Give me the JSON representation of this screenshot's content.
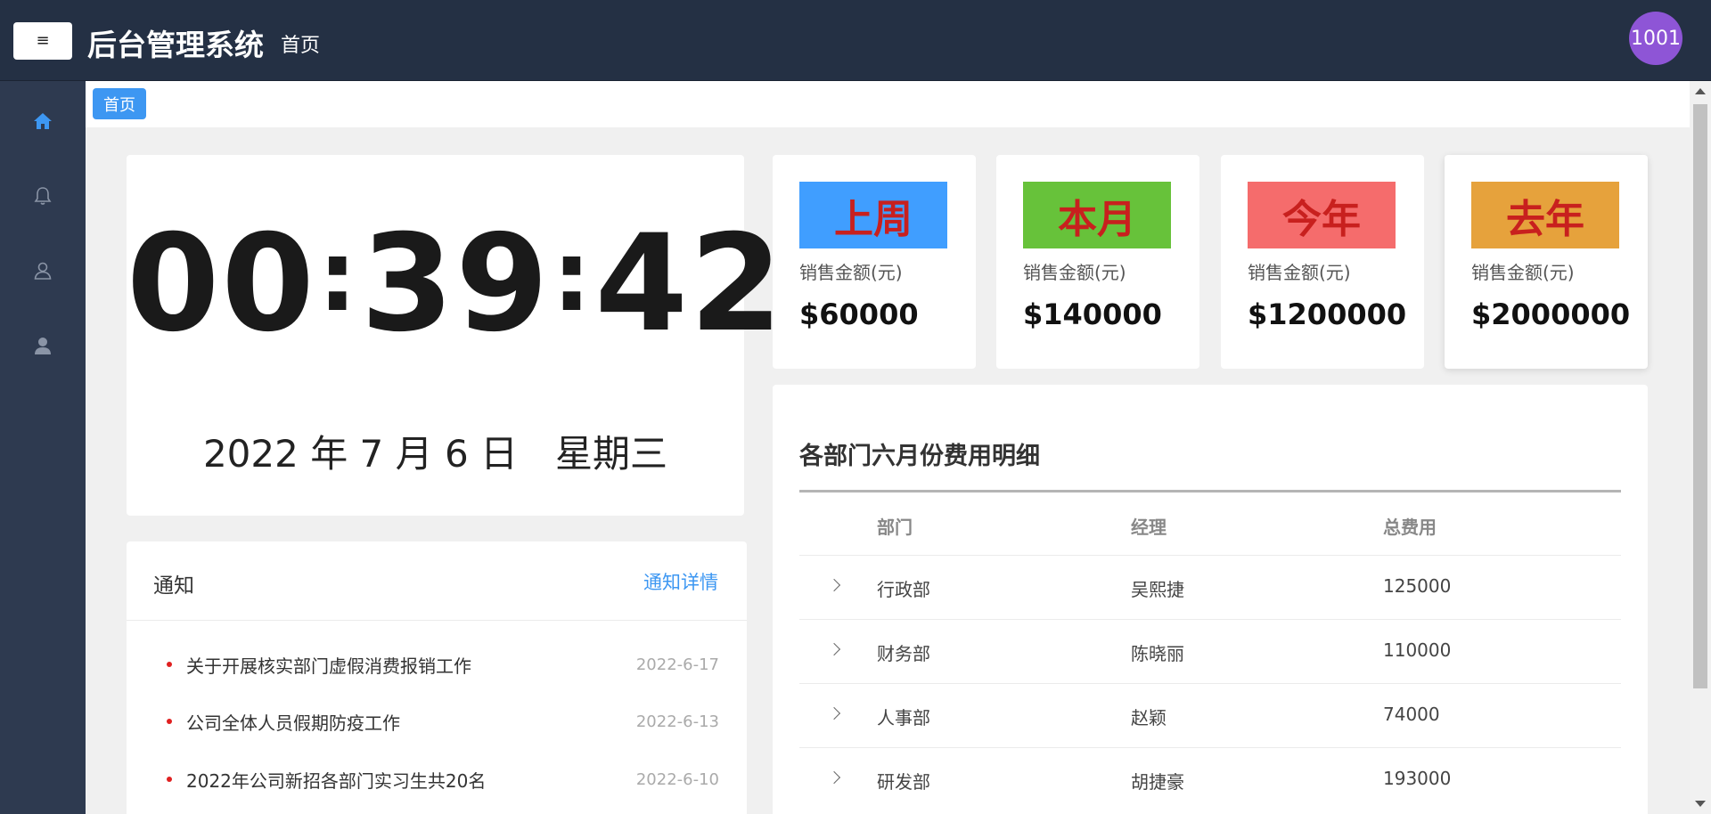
{
  "header": {
    "menu_icon": "≡",
    "app_title": "后台管理系统",
    "breadcrumb": "首页",
    "avatar_text": "1001"
  },
  "sidebar": {
    "items": [
      {
        "icon": "home-icon",
        "active": true
      },
      {
        "icon": "bell-icon",
        "active": false
      },
      {
        "icon": "user-outline-icon",
        "active": false
      },
      {
        "icon": "user-filled-icon",
        "active": false
      }
    ]
  },
  "tabs": [
    {
      "label": "首页",
      "active": true
    }
  ],
  "clock": {
    "hours": "00",
    "minutes": "39",
    "seconds": "42",
    "separator": ":",
    "date": "2022 年 7 月 6 日　星期三"
  },
  "notices": {
    "title": "通知",
    "link": "通知详情",
    "items": [
      {
        "text": "关于开展核实部门虚假消费报销工作",
        "date": "2022-6-17"
      },
      {
        "text": "公司全体人员假期防疫工作",
        "date": "2022-6-13"
      },
      {
        "text": "2022年公司新招各部门实习生共20名",
        "date": "2022-6-10"
      }
    ]
  },
  "stats": [
    {
      "badge": "上周",
      "color": "#409eff",
      "label": "销售金额(元)",
      "value": "$60000"
    },
    {
      "badge": "本月",
      "color": "#67c23a",
      "label": "销售金额(元)",
      "value": "$140000"
    },
    {
      "badge": "今年",
      "color": "#f56c6c",
      "label": "销售金额(元)",
      "value": "$1200000"
    },
    {
      "badge": "去年",
      "color": "#e6a23c",
      "label": "销售金额(元)",
      "value": "$2000000"
    }
  ],
  "table": {
    "title": "各部门六月份费用明细",
    "headers": {
      "dept": "部门",
      "manager": "经理",
      "total": "总费用"
    },
    "rows": [
      {
        "dept": "行政部",
        "manager": "吴熙捷",
        "total": "125000"
      },
      {
        "dept": "财务部",
        "manager": "陈晓丽",
        "total": "110000"
      },
      {
        "dept": "人事部",
        "manager": "赵颖",
        "total": "74000"
      },
      {
        "dept": "研发部",
        "manager": "胡捷豪",
        "total": "193000"
      }
    ]
  },
  "colors": {
    "header_bg": "#243044",
    "sidebar_bg": "#2e3a50",
    "accent": "#3d97f2",
    "active_icon": "#3d97f2",
    "inactive_icon": "#8a94a6"
  }
}
